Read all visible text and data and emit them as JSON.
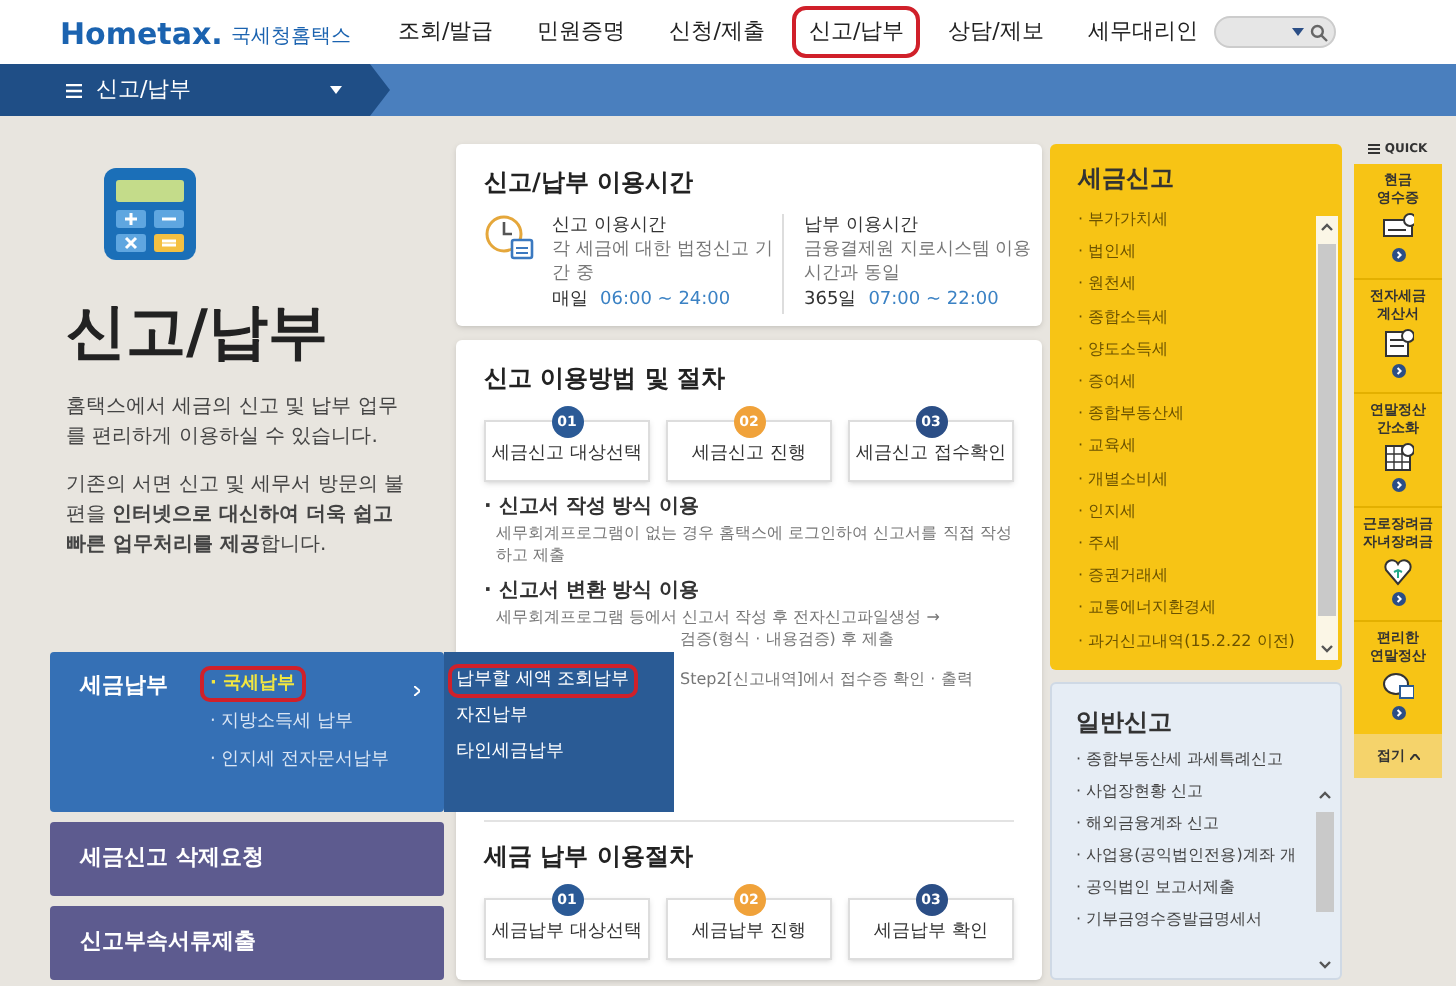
{
  "header": {
    "logo": "Hometax.",
    "logo_subtitle": "국세청홈택스",
    "nav": [
      {
        "label": "조회/발급",
        "circled": false
      },
      {
        "label": "민원증명",
        "circled": false
      },
      {
        "label": "신청/제출",
        "circled": false
      },
      {
        "label": "신고/납부",
        "circled": true
      },
      {
        "label": "상담/제보",
        "circled": false
      },
      {
        "label": "세무대리인",
        "circled": false
      }
    ]
  },
  "breadcrumb": {
    "label": "신고/납부"
  },
  "intro": {
    "title": "신고/납부",
    "paragraphs": [
      "홈택스에서 세금의 신고 및 납부 업무를 편리하게 이용하실 수 있습니다.",
      "기존의 서면 신고 및 세무서 방문의 불편을 **인터넷으로 대신하여 더욱 쉽고 빠른 업무처리를 제공**합니다."
    ]
  },
  "left_menu": [
    {
      "label": "세금납부",
      "expanded": true,
      "children": [
        {
          "label": "· 국세납부",
          "circled": true,
          "selected": true,
          "children": [
            {
              "label": "납부할 세액 조회납부",
              "circled": true
            },
            {
              "label": "자진납부",
              "circled": false
            },
            {
              "label": "타인세금납부",
              "circled": false
            }
          ]
        },
        {
          "label": "· 지방소득세 납부",
          "circled": false,
          "selected": false
        },
        {
          "label": "· 인지세 전자문서납부",
          "circled": false,
          "selected": false
        }
      ]
    },
    {
      "label": "세금신고 삭제요청",
      "expanded": false
    },
    {
      "label": "신고부속서류제출",
      "expanded": false
    }
  ],
  "hours_card": {
    "title": "신고/납부 이용시간",
    "blocks": [
      {
        "title": "신고 이용시간",
        "desc": "각 세금에 대한 법정신고 기간 중",
        "day": "매일",
        "hours": "06:00 ~ 24:00"
      },
      {
        "title": "납부 이용시간",
        "desc": "금융결제원 지로시스템 이용시간과 동일",
        "day": "365일",
        "hours": "07:00 ~ 22:00"
      }
    ]
  },
  "filing_card": {
    "title": "신고 이용방법 및 절차",
    "steps": [
      {
        "number": "01",
        "label": "세금신고 대상선택",
        "color": "#2b5a96"
      },
      {
        "number": "02",
        "label": "세금신고 진행",
        "color": "#f0a23a"
      },
      {
        "number": "03",
        "label": "세금신고 접수확인",
        "color": "#2b4e86"
      }
    ],
    "methods": [
      {
        "title": "· 신고서 작성 방식 이용",
        "lines": [
          "세무회계프로그램이 없는 경우 홈택스에 로그인하여 신고서를 직접 작성하고 제출"
        ]
      },
      {
        "title": "· 신고서 변환 방식 이용",
        "lines": [
          "세무회계프로그램 등에서 신고서 작성 후 전자신고파일생성 →",
          "검증(형식 · 내용검증) 후 제출",
          "Step2[신고내역]에서 접수증 확인 · 출력"
        ]
      }
    ],
    "payment_title": "세금 납부 이용절차",
    "payment_steps": [
      {
        "number": "01",
        "label": "세금납부 대상선택",
        "color": "#2b5a96"
      },
      {
        "number": "02",
        "label": "세금납부 진행",
        "color": "#f0a23a"
      },
      {
        "number": "03",
        "label": "세금납부 확인",
        "color": "#2b4e86"
      }
    ]
  },
  "tax_filing": {
    "title": "세금신고",
    "items": [
      "· 부가가치세",
      "· 법인세",
      "· 원천세",
      "· 종합소득세",
      "· 양도소득세",
      "· 증여세",
      "· 종합부동산세",
      "· 교육세",
      "· 개별소비세",
      "· 인지세",
      "· 주세",
      "· 증권거래세",
      "· 교통에너지환경세",
      "· 과거신고내역(15.2.22 이전)"
    ]
  },
  "general_filing": {
    "title": "일반신고",
    "items": [
      "· 종합부동산세 과세특례신고",
      "· 사업장현황 신고",
      "· 해외금융계좌 신고",
      "· 사업용(공익법인전용)계좌 개",
      "· 공익법인 보고서제출",
      "· 기부금영수증발급명세서"
    ]
  },
  "quick": {
    "title": "QUICK",
    "items": [
      {
        "lines": [
          "현금",
          "영수증"
        ]
      },
      {
        "lines": [
          "전자세금",
          "계산서"
        ]
      },
      {
        "lines": [
          "연말정산",
          "간소화"
        ]
      },
      {
        "lines": [
          "근로장려금",
          "자녀장려금"
        ]
      },
      {
        "lines": [
          "편리한",
          "연말정산"
        ]
      }
    ],
    "collapse": "접기"
  }
}
